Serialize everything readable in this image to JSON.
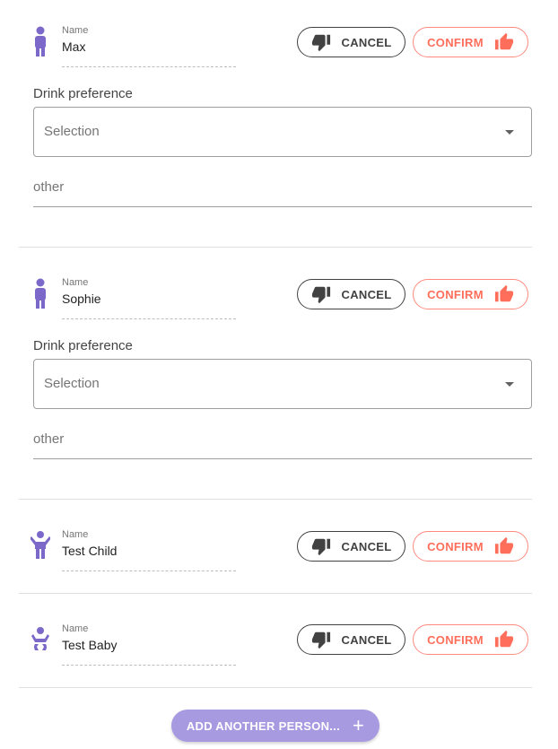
{
  "colors": {
    "accent": "#7b68c8",
    "confirm": "#ff6e5a",
    "cancel": "#424242",
    "add_button_bg": "#a79ae0"
  },
  "persons": [
    {
      "avatar_icon": "adult-person-icon",
      "name_label": "Name",
      "name": "Max",
      "cancel_label": "CANCEL",
      "confirm_label": "CONFIRM",
      "drink_label": "Drink preference",
      "select_placeholder": "Selection",
      "other_label": "other"
    },
    {
      "avatar_icon": "adult-person-icon",
      "name_label": "Name",
      "name": "Sophie",
      "cancel_label": "CANCEL",
      "confirm_label": "CONFIRM",
      "drink_label": "Drink preference",
      "select_placeholder": "Selection",
      "other_label": "other"
    },
    {
      "avatar_icon": "child-person-icon",
      "name_label": "Name",
      "name": "Test Child",
      "cancel_label": "CANCEL",
      "confirm_label": "CONFIRM"
    },
    {
      "avatar_icon": "baby-person-icon",
      "name_label": "Name",
      "name": "Test Baby",
      "cancel_label": "CANCEL",
      "confirm_label": "CONFIRM"
    }
  ],
  "add_person_label": "ADD ANOTHER PERSON..."
}
